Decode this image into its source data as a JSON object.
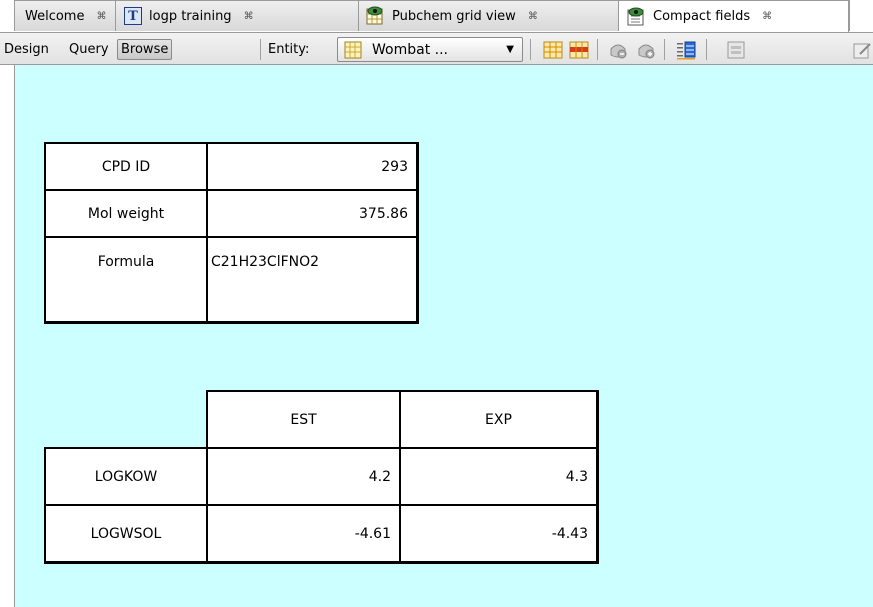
{
  "tabs": [
    {
      "label": "Welcome",
      "icon": "none",
      "active": false
    },
    {
      "label": "logp training",
      "icon": "text-t-icon",
      "active": false
    },
    {
      "label": "Pubchem grid view",
      "icon": "grid-view-icon",
      "active": false
    },
    {
      "label": "Compact fields",
      "icon": "form-view-icon",
      "active": true
    }
  ],
  "tab_close_glyph": "⌘",
  "toolbar": {
    "design_label": "Design",
    "query_label": "Query",
    "browse_label": "Browse",
    "entity_label": "Entity:",
    "entity_value": "Wombat ...",
    "entity_arrow": "▼"
  },
  "colors": {
    "content_background": "#ccffff",
    "cell_background": "#ffffff",
    "cell_border": "#000000"
  },
  "fields": [
    {
      "label": "CPD ID",
      "value": "293"
    },
    {
      "label": "Mol weight",
      "value": "375.86"
    },
    {
      "label": "Formula",
      "value": "C21H23ClFNO2"
    }
  ],
  "properties": {
    "columns": [
      "EST",
      "EXP"
    ],
    "rows": [
      {
        "label": "LOGKOW",
        "est": "4.2",
        "exp": "4.3"
      },
      {
        "label": "LOGWSOL",
        "est": "-4.61",
        "exp": "-4.43"
      }
    ]
  }
}
